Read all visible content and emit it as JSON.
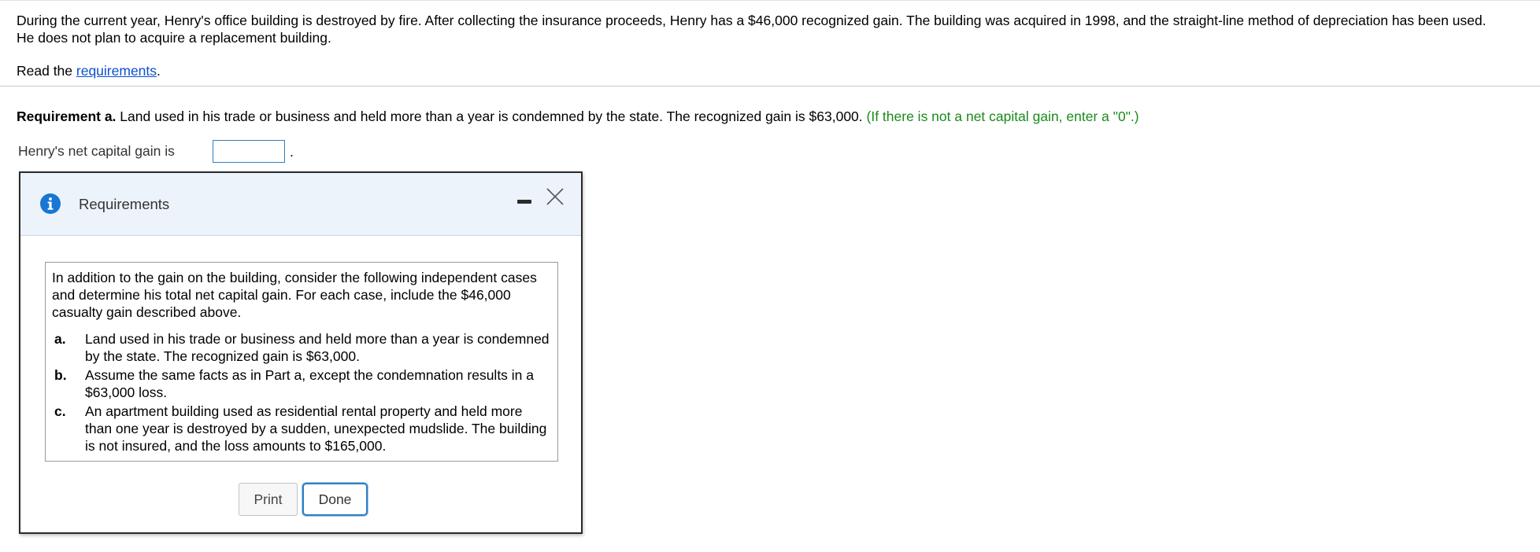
{
  "problem": {
    "intro_line1": "During the current year, Henry's office building is destroyed by fire. After collecting the insurance proceeds, Henry has a $46,000 recognized gain. The building was acquired in 1998, and the straight-line method of depreciation has been used.",
    "intro_line2": "He does not plan to acquire a replacement building.",
    "read_prefix": "Read the ",
    "read_link": "requirements",
    "read_suffix": "."
  },
  "requirement_a": {
    "label": "Requirement a.",
    "text": " Land used in his trade or business and held more than a year is condemned by the state. The recognized gain is $63,000. ",
    "hint": "(If there is not a net capital gain, enter a \"0\".)",
    "answer_label": "Henry's net capital gain is",
    "answer_value": "",
    "answer_suffix": "."
  },
  "dialog": {
    "title": "Requirements",
    "intro": "In addition to the gain on the building, consider the following independent cases and determine his total net capital gain. For each case, include the $46,000 casualty gain described above.",
    "cases": [
      {
        "letter": "a.",
        "text": "Land used in his trade or business and held more than a year is condemned by the state. The recognized gain is $63,000."
      },
      {
        "letter": "b.",
        "text": "Assume the same facts as in Part a, except the condemnation results in a $63,000 loss."
      },
      {
        "letter": "c.",
        "text": "An apartment building used as residential rental property and held more than one year is destroyed by a sudden, unexpected mudslide. The building is not insured, and the loss amounts to $165,000."
      }
    ],
    "print_label": "Print",
    "done_label": "Done"
  },
  "colors": {
    "link": "#0a4fd0",
    "hint_green": "#1a8a1a",
    "info_blue": "#1976d2",
    "header_bg": "#edf3fb",
    "focus_blue": "#2f7fc1"
  },
  "icons": {
    "info": "info-circle-icon",
    "minimize": "minimize-icon",
    "close": "close-x-icon"
  }
}
